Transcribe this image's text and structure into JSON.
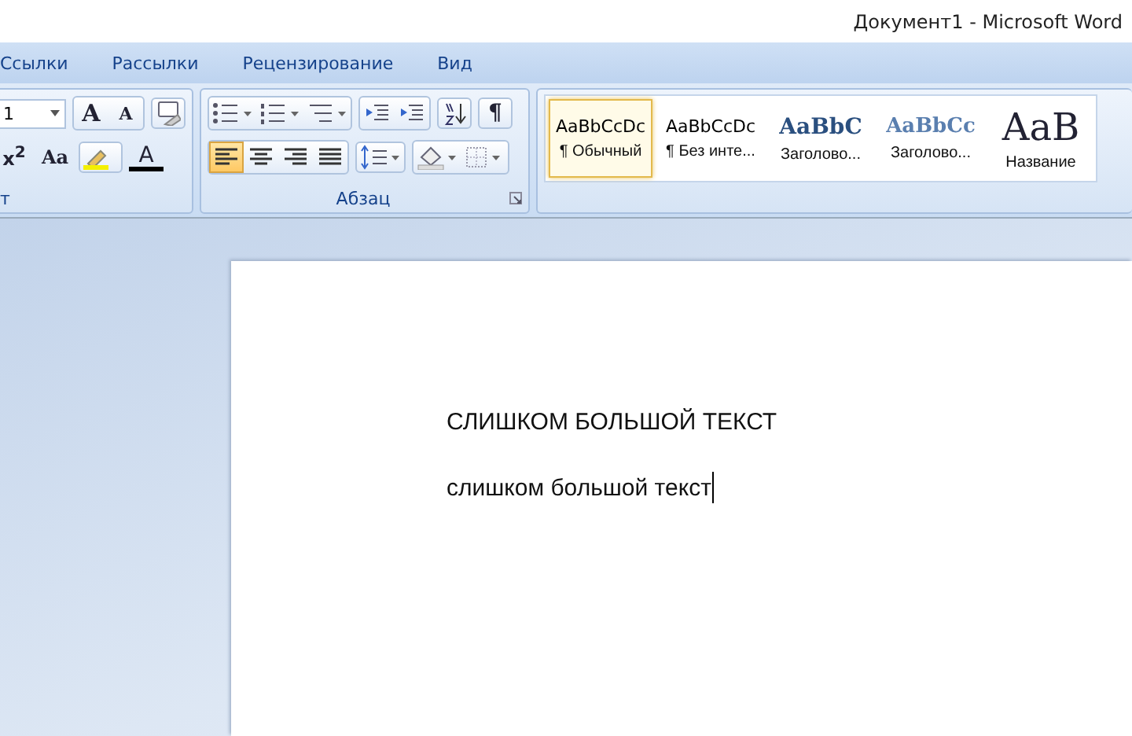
{
  "window": {
    "title": "Документ1 - Microsoft Word"
  },
  "tabs": [
    {
      "label": "Ссылки",
      "selected": false
    },
    {
      "label": "Рассылки",
      "selected": false
    },
    {
      "label": "Рецензирование",
      "selected": false
    },
    {
      "label": "Вид",
      "selected": false
    }
  ],
  "font_group": {
    "label": "т",
    "size": "1",
    "grow": "A",
    "shrink": "A",
    "superscript": "x$^{2}$",
    "case": "Aa",
    "font_color": "A"
  },
  "paragraph_group": {
    "label": "Абзац",
    "pilcrow": "¶",
    "align_buttons": [
      {
        "kind": "left",
        "selected": true
      },
      {
        "kind": "center",
        "selected": false
      },
      {
        "kind": "right",
        "selected": false
      },
      {
        "kind": "justify",
        "selected": false
      }
    ]
  },
  "styles": [
    {
      "preview": "AaBbCcDc",
      "name": "¶ Обычный",
      "kind": "normal",
      "selected": true
    },
    {
      "preview": "AaBbCcDc",
      "name": "¶ Без инте...",
      "kind": "normal",
      "selected": false
    },
    {
      "preview": "AaBbC",
      "name": "Заголово...",
      "kind": "heading1",
      "selected": false
    },
    {
      "preview": "AaBbCc",
      "name": "Заголово...",
      "kind": "heading2",
      "selected": false
    },
    {
      "preview": "AaB",
      "name": "Название",
      "kind": "title",
      "selected": false
    }
  ],
  "document": {
    "lines": [
      "СЛИШКОМ БОЛЬШОЙ ТЕКСТ",
      "слишком большой текст"
    ]
  }
}
